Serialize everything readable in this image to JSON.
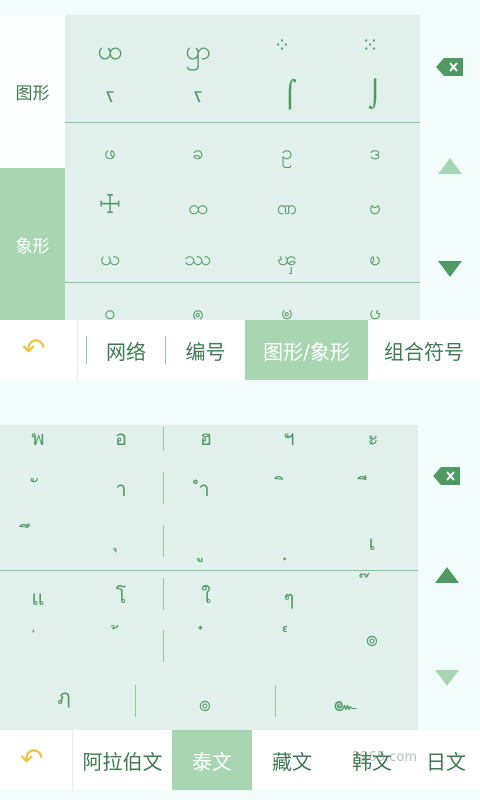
{
  "top_panel": {
    "side_tabs": [
      {
        "label": "图形",
        "active": false
      },
      {
        "label": "象形",
        "active": true
      }
    ],
    "rows": [
      [
        "ꩤ",
        "ꩥ",
        "⁘",
        "⁙"
      ],
      [
        "ꧏ",
        "ꧏ",
        "⌠",
        "⌡"
      ],
      [
        "ဖ",
        "ခ",
        "ဥ",
        "ဒ"
      ],
      [
        "☩",
        "ထ",
        "ဏ",
        "ဗ"
      ],
      [
        "ယ",
        "ဿ",
        "ၾ",
        "ၿ"
      ],
      [
        "ဝ",
        "ၐ",
        "ၑ",
        "ၒ"
      ]
    ],
    "bottom_bar": {
      "tabs": [
        {
          "label": "网络",
          "active": false
        },
        {
          "label": "编号",
          "active": false
        },
        {
          "label": "图形/象形",
          "active": true
        },
        {
          "label": "组合符号",
          "active": false
        }
      ]
    }
  },
  "bottom_panel": {
    "rows": [
      [
        "พ",
        "อ",
        "ฮ",
        "ฯ",
        "ะ"
      ],
      [
        "ั",
        "า",
        "ำ",
        "ิ",
        "ี"
      ],
      [
        "ึ",
        "ุ",
        "ู",
        "ฺ",
        "เ"
      ],
      [
        "แ",
        "โ",
        "ใ",
        "ๆ",
        "๊"
      ],
      [
        "่",
        "้",
        "๋",
        "๎",
        "๏"
      ],
      [
        "ฦ",
        "๏",
        "๛"
      ]
    ],
    "bottom_bar": {
      "tabs": [
        {
          "label": "阿拉伯文",
          "active": false
        },
        {
          "label": "泰文",
          "active": true
        },
        {
          "label": "藏文",
          "active": false
        },
        {
          "label": "韩文",
          "active": false
        },
        {
          "label": "日文",
          "active": false
        }
      ]
    },
    "watermark": "2265.com"
  },
  "icons": {
    "backspace": "backspace-icon",
    "scroll_up": "triangle-up-icon",
    "scroll_down": "triangle-down-icon",
    "return": "return-arrow-icon"
  },
  "colors": {
    "accent": "#a8d5b2",
    "symbol": "#4e9a62",
    "panel": "#e1f0ea",
    "back_arrow": "#f2c445"
  }
}
